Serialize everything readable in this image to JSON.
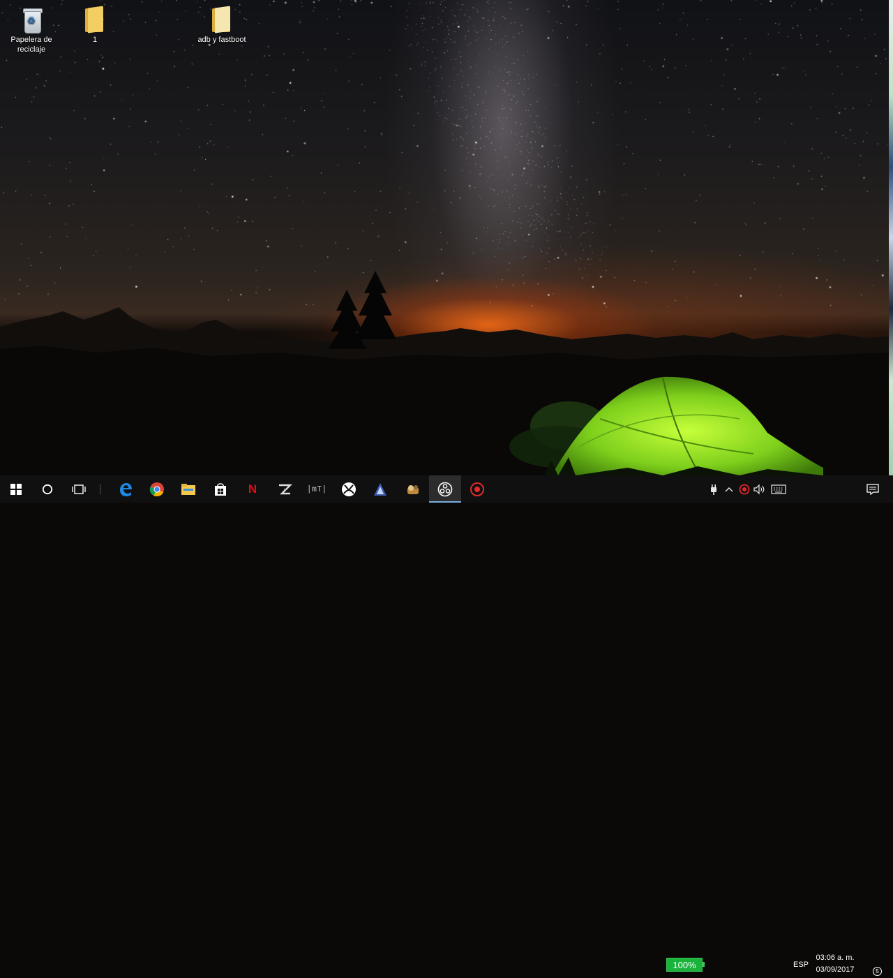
{
  "desktop": {
    "icons": [
      {
        "label": "Papelera de reciclaje",
        "icon": "recycle-bin-icon"
      },
      {
        "label": "1",
        "icon": "folder-icon"
      },
      {
        "label": "adb y fastboot",
        "icon": "folder-icon"
      }
    ],
    "wallpaper": "night-sky-milky-way-green-tent"
  },
  "taskbar": {
    "apps": [
      {
        "name": "start",
        "icon": "windows-logo-icon"
      },
      {
        "name": "cortana",
        "icon": "circle-search-icon"
      },
      {
        "name": "task-view",
        "icon": "task-view-icon"
      },
      {
        "name": "edge",
        "icon": "edge-browser-icon"
      },
      {
        "name": "chrome",
        "icon": "chrome-icon"
      },
      {
        "name": "file-explorer",
        "icon": "file-explorer-icon"
      },
      {
        "name": "store",
        "icon": "store-icon"
      },
      {
        "name": "netflix",
        "icon": "netflix-icon",
        "glyph": "N"
      },
      {
        "name": "app-z",
        "icon": "z-app-icon"
      },
      {
        "name": "mytube",
        "icon": "mytube-icon",
        "glyph": "|mT|"
      },
      {
        "name": "xbox",
        "icon": "xbox-icon"
      },
      {
        "name": "app-triangle",
        "icon": "triangle-app-icon"
      },
      {
        "name": "app-game",
        "icon": "game-app-icon"
      },
      {
        "name": "obs",
        "icon": "obs-icon",
        "active": true
      },
      {
        "name": "app-red",
        "icon": "red-circle-app-icon"
      }
    ],
    "tray": {
      "battery_percent": "100%",
      "language": "ESP",
      "time": "03:06 a. m.",
      "date": "03/09/2017",
      "notification_count": "5"
    }
  },
  "colors": {
    "taskbar_bg": "#101010",
    "battery_green": "#19b23b",
    "active_indicator": "#7aaee0"
  }
}
